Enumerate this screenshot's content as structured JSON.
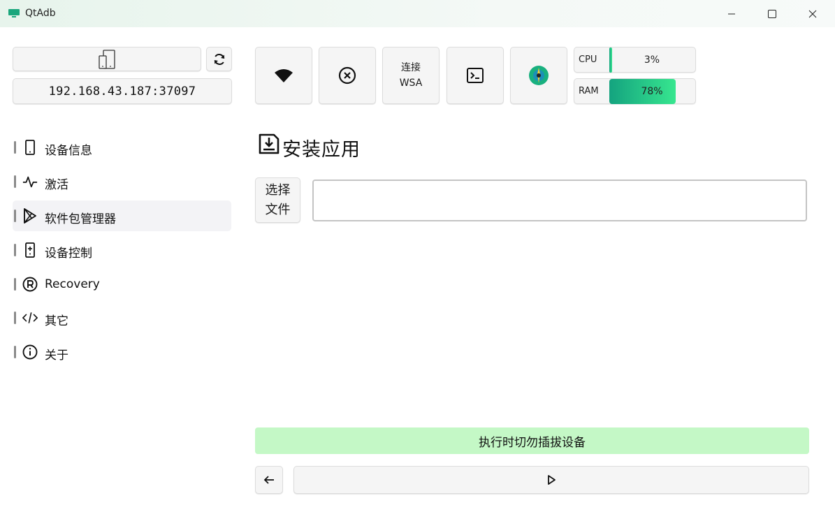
{
  "window": {
    "title": "QtAdb"
  },
  "device": {
    "address": "192.168.43.187:37097"
  },
  "toolbar": {
    "wsa_label_line1": "连接",
    "wsa_label_line2": "WSA"
  },
  "meters": {
    "cpu": {
      "label": "CPU",
      "value_text": "3%",
      "fraction": 0.03
    },
    "ram": {
      "label": "RAM",
      "value_text": "78%",
      "fraction": 0.78
    }
  },
  "sidebar": {
    "items": [
      {
        "label": "设备信息",
        "icon": "phone-icon"
      },
      {
        "label": "激活",
        "icon": "activity-icon"
      },
      {
        "label": "软件包管理器",
        "icon": "play-store-icon",
        "active": true
      },
      {
        "label": "设备控制",
        "icon": "remote-icon"
      },
      {
        "label": "Recovery",
        "icon": "registered-icon"
      },
      {
        "label": "其它",
        "icon": "code-icon"
      },
      {
        "label": "关于",
        "icon": "info-icon"
      }
    ]
  },
  "main": {
    "title": "安装应用",
    "choose_file_line1": "选择",
    "choose_file_line2": "文件",
    "file_path": "",
    "status": "执行时切勿插拔设备"
  },
  "colors": {
    "accent": "#19b07f",
    "status_bg": "#c4f8c6"
  }
}
